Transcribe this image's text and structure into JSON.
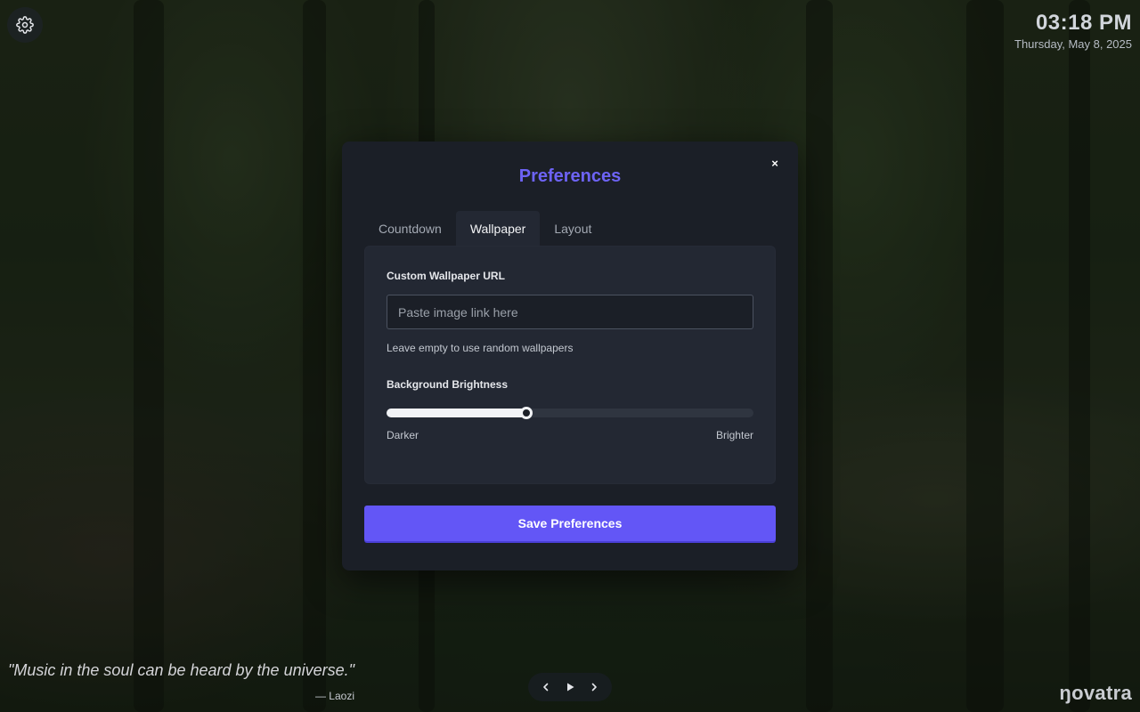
{
  "clock": {
    "time": "03:18 PM",
    "date": "Thursday, May 8, 2025"
  },
  "quote": {
    "text": "\"Music in the soul can be heard by the universe.\"",
    "author": "— Laozi"
  },
  "brand": "ŋovatra",
  "modal": {
    "title": "Preferences",
    "close_label": "×",
    "tabs": [
      {
        "label": "Countdown",
        "active": false
      },
      {
        "label": "Wallpaper",
        "active": true
      },
      {
        "label": "Layout",
        "active": false
      }
    ],
    "wallpaper": {
      "url_label": "Custom Wallpaper URL",
      "url_value": "",
      "url_placeholder": "Paste image link here",
      "url_hint": "Leave empty to use random wallpapers",
      "brightness_label": "Background Brightness",
      "brightness_value": 0.38,
      "min_label": "Darker",
      "max_label": "Brighter"
    },
    "save_label": "Save Preferences"
  },
  "icons": {
    "settings": "gear-icon",
    "prev": "chevron-left-icon",
    "play": "play-icon",
    "next": "chevron-right-icon"
  },
  "colors": {
    "accent": "#6356f6",
    "title": "#6d63f5",
    "modal_bg": "#1b1f27",
    "panel_bg": "#232833"
  }
}
